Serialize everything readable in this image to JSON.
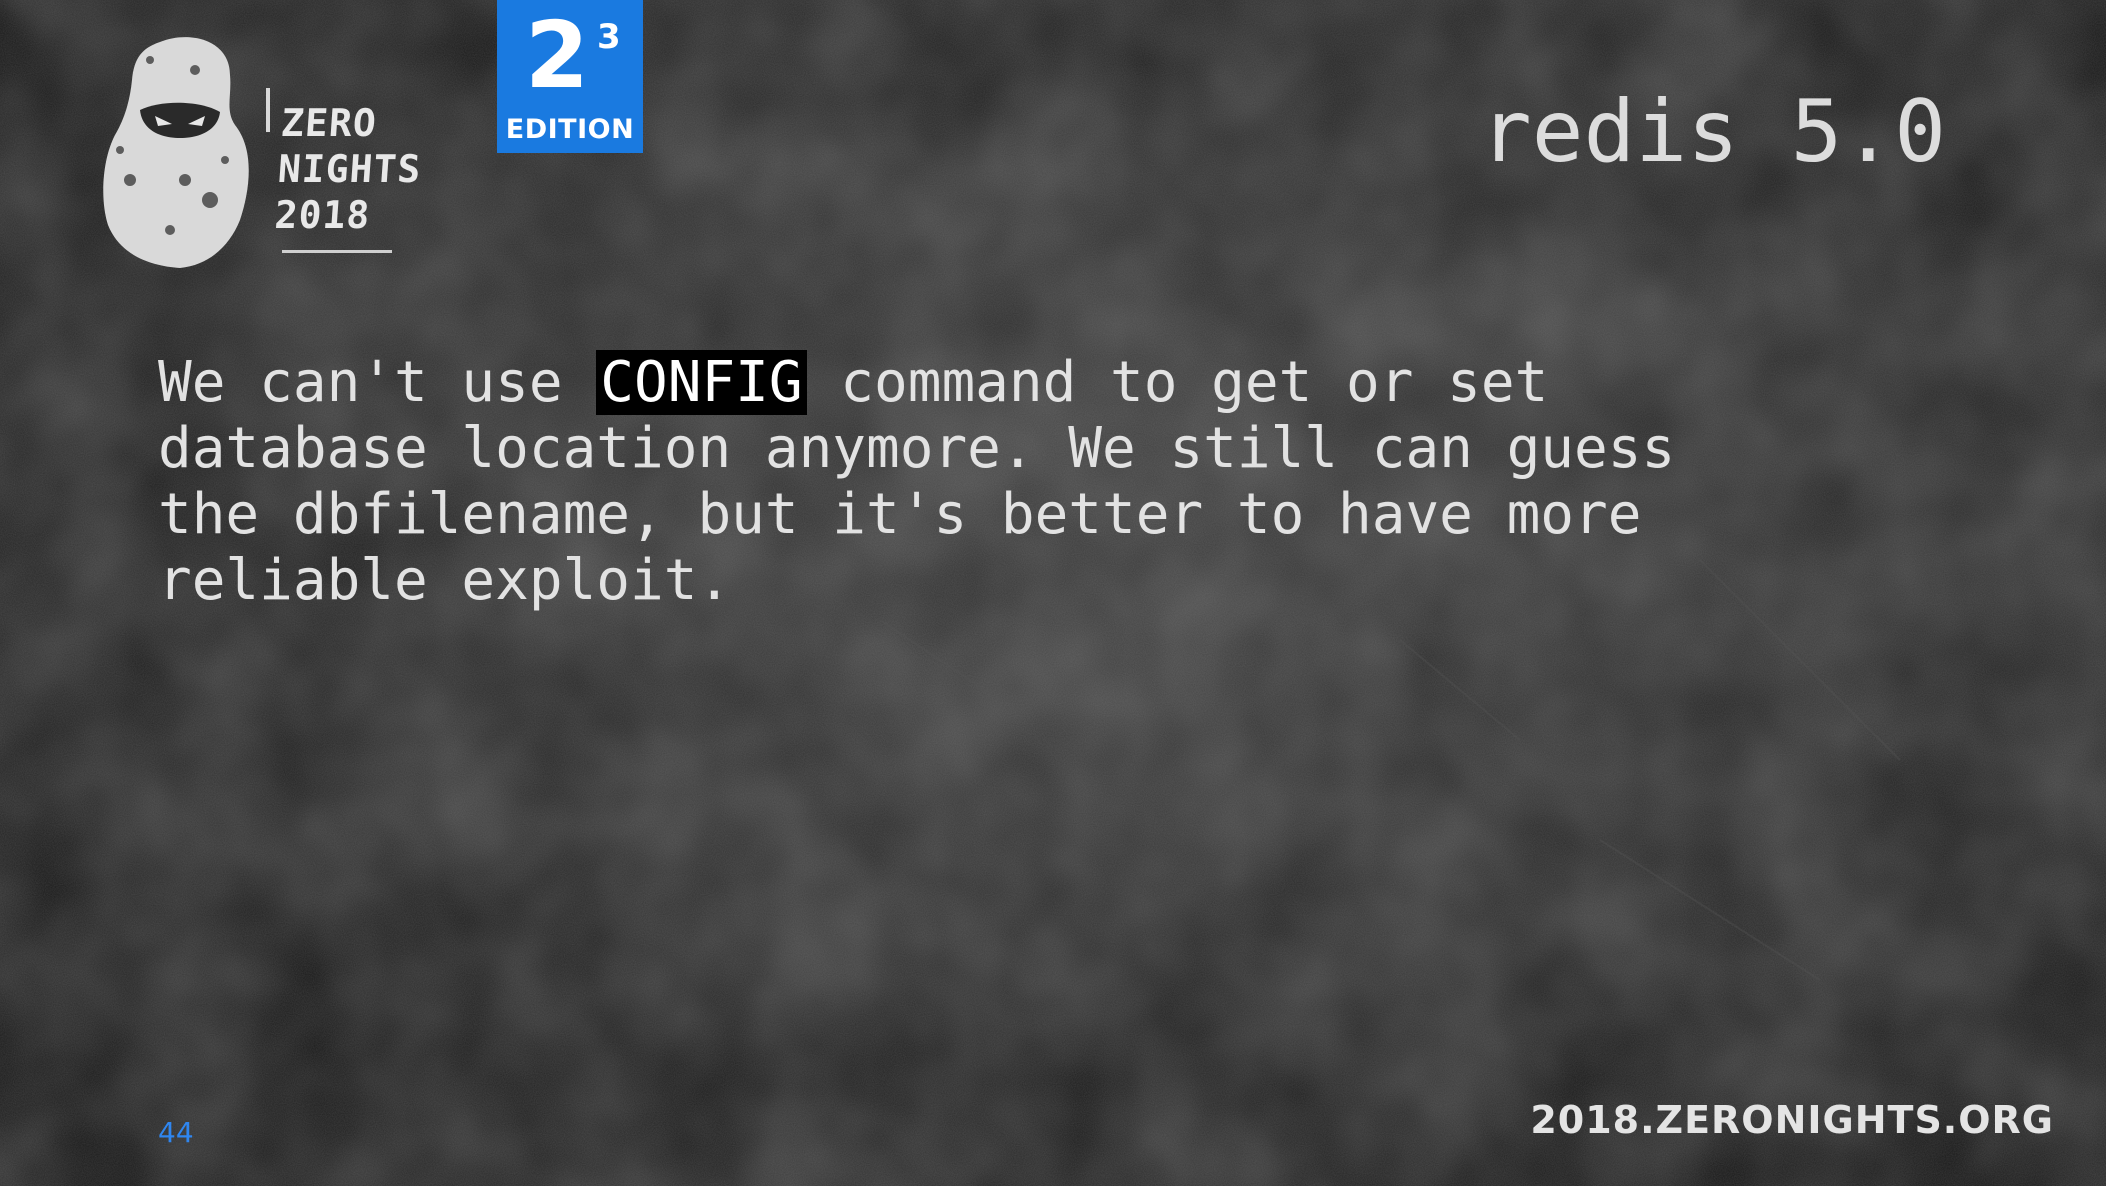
{
  "slide": {
    "title": "redis 5.0",
    "body_lines": [
      [
        "We can't use ",
        "CONFIG",
        " command to get or set"
      ],
      "database location anymore. We still can guess",
      "the dbfilename, but it's better to have more",
      "reliable exploit."
    ],
    "page_number": "44",
    "footer_url": "2018.ZERONIGHTS.ORG"
  },
  "logo": {
    "lines": [
      "ZERO",
      "NIGHTS",
      "2018"
    ],
    "icon": "hooded-figure-icon"
  },
  "edition_badge": {
    "base": "2",
    "exponent": "3",
    "label": "EDITION",
    "color": "#1a7ae0"
  },
  "colors": {
    "accent_blue": "#2f86f0",
    "text": "#e2e2e2",
    "highlight_bg": "#000000"
  }
}
